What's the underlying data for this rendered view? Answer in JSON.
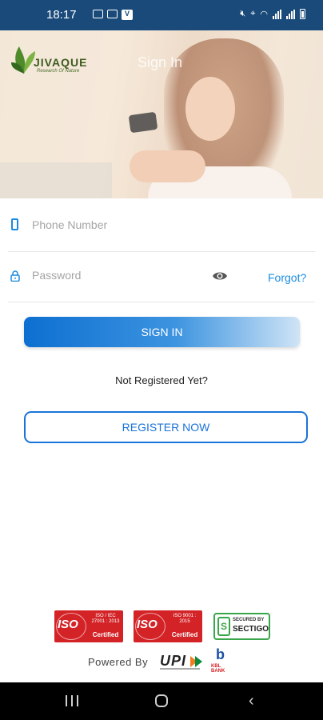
{
  "status_bar": {
    "time": "18:17",
    "v_badge": "V",
    "network_label": "Vo) LTE2"
  },
  "header": {
    "logo_brand": "JIVAQUE",
    "logo_tagline": "Research Of Nature",
    "title": "Sign In"
  },
  "form": {
    "phone_placeholder": "Phone Number",
    "password_placeholder": "Password",
    "forgot_label": "Forgot?",
    "signin_label": "SIGN IN",
    "not_registered_text": "Not Registered Yet?",
    "register_label": "REGISTER NOW"
  },
  "badges": {
    "iso1_big": "ISO",
    "iso1_small": "ISO / IEC 27001 : 2013",
    "iso1_cert": "Certified",
    "iso2_big": "ISO",
    "iso2_small": "ISO 9001 : 2015",
    "iso2_cert": "Certified",
    "sectigo_top": "SECURED BY",
    "sectigo_name": "SECTIGO",
    "powered_by": "Powered By",
    "upi_text": "UPI",
    "kbl_letter": "b",
    "kbl_text": "KBL BANK"
  },
  "colors": {
    "accent": "#1a8de0",
    "status_bar": "#1a4a7a",
    "register_border": "#1a73d9"
  },
  "icons": [
    "phone-icon",
    "lock-icon",
    "eye-icon",
    "leaf-logo-icon"
  ]
}
